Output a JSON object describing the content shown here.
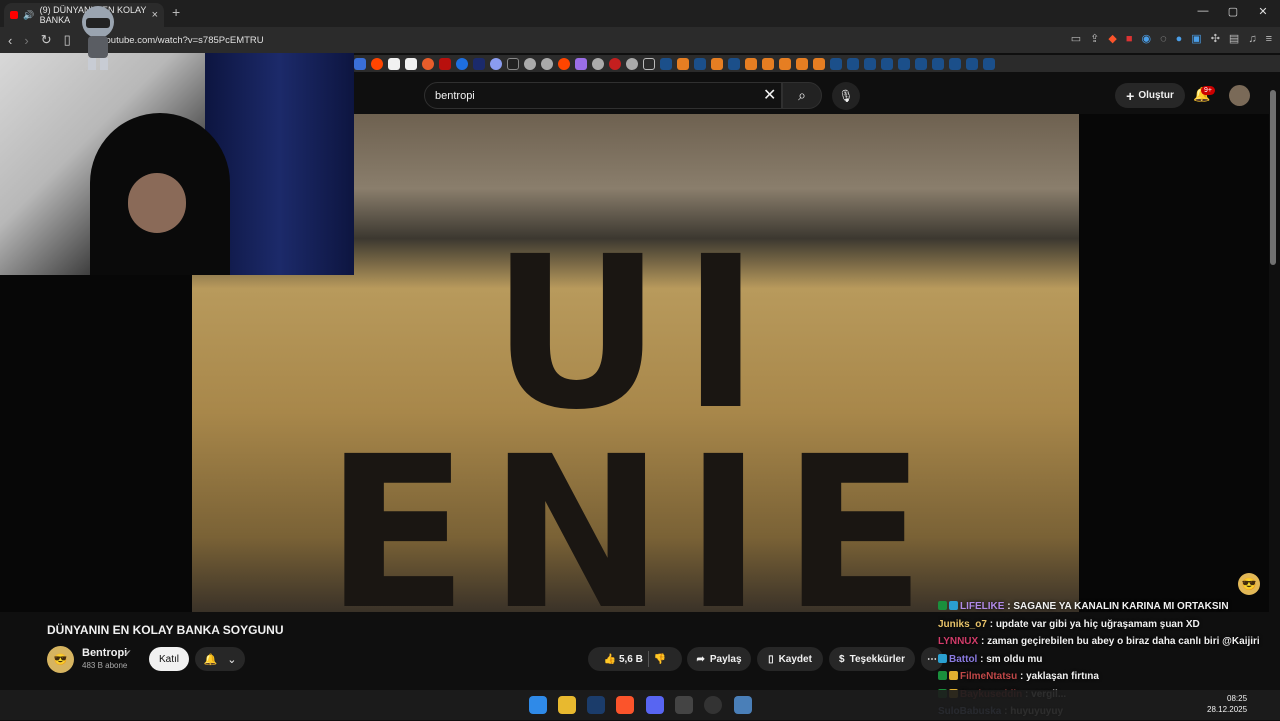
{
  "browser": {
    "tab_title": "(9) DÜNYANIN EN KOLAY BANKA",
    "url": "youtube.com/watch?v=s785PcEMTRU",
    "new_tab": "+",
    "close_tab": "×",
    "window_controls": [
      "—",
      "▢",
      "✕"
    ]
  },
  "youtube": {
    "search_value": "bentropi",
    "create_label": "Oluştur",
    "notifications_badge": "9+",
    "video_overlay_text": "UI ENIE",
    "video_title": "DÜNYANIN EN KOLAY BANKA SOYGUNU",
    "channel": {
      "name": "Bentropi",
      "subscribers": "483 B abone",
      "join_label": "Katıl"
    },
    "actions": {
      "likes": "5,6 B",
      "share": "Paylaş",
      "save": "Kaydet",
      "thanks": "Teşekkürler",
      "more": "⋯"
    }
  },
  "chat": [
    {
      "user": "LIFELIKE",
      "message": "SAGANE YA KANALIN KARINA MI ORTAKSIN",
      "color": "#b18ae6",
      "badges": [
        "#1a8f3c",
        "#2aa0d0"
      ]
    },
    {
      "user": "Juniks_o7",
      "message": "update var gibi ya hiç uğraşamam şuan XD",
      "color": "#e8c36a",
      "badges": []
    },
    {
      "user": "LYNNUX",
      "message": "zaman geçirebilen bu abey o biraz daha canlı biri @Kaijiri",
      "color": "#d23c6a",
      "badges": []
    },
    {
      "user": "Battol",
      "message": "sm oldu mu",
      "color": "#8a7ae0",
      "badges": [
        "#2aa0d0"
      ]
    },
    {
      "user": "FilmeNtatsu",
      "message": "yaklaşan firtına",
      "color": "#c04848",
      "badges": [
        "#1a8f3c",
        "#e0b030"
      ]
    },
    {
      "user": "Baykuseddin",
      "message": "vergil...",
      "color": "#c04848",
      "badges": [
        "#1a8f3c",
        "#e0b030"
      ]
    },
    {
      "user": "SuloBabuska",
      "message": "huyuyuyuy",
      "color": "#a0b8ff",
      "badges": []
    }
  ],
  "taskbar": {
    "time": "08:25",
    "date": "28.12.2025"
  }
}
